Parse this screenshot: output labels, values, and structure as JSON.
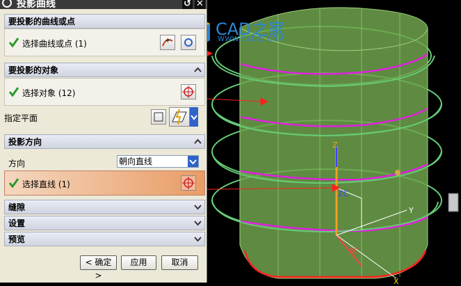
{
  "dialog": {
    "title": "投影曲线",
    "sections": {
      "curves": {
        "header": "要投影的曲线或点",
        "select_label": "选择曲线或点 (1)"
      },
      "objects": {
        "header": "要投影的对象",
        "select_label": "选择对象 (12)",
        "plane_label": "指定平面"
      },
      "direction": {
        "header": "投影方向",
        "direction_label": "方向",
        "direction_value": "朝向直线",
        "select_label": "选择直线 (1)"
      },
      "gap": {
        "header": "缝隙"
      },
      "settings": {
        "header": "设置"
      },
      "preview": {
        "header": "预览"
      }
    },
    "buttons": {
      "ok": "< 确定 >",
      "apply": "应用",
      "cancel": "取消"
    }
  },
  "watermark": {
    "brand": "CAD之家",
    "url": "WWW.CADZJ.COM"
  },
  "axes": {
    "z": "Z",
    "y": "Y",
    "x": "X",
    "zc": "ZC",
    "xc": "XC"
  },
  "colors": {
    "panel": "#ece9d8",
    "section_header": "#d6dbe7",
    "highlight": "#e9a06e",
    "model": "#6fa34c",
    "spiral": "#6fd07a",
    "projected_curve": "#e020e0",
    "arrow": "#ff2020"
  }
}
